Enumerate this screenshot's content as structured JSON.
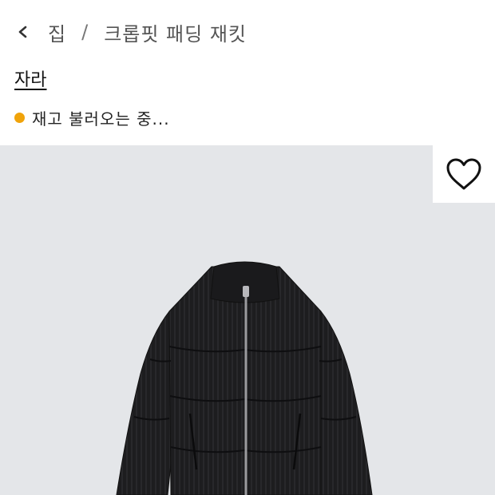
{
  "breadcrumb": {
    "home": "집",
    "separator": "/",
    "current": "크롭핏 패딩 재킷"
  },
  "brand": "자라",
  "stock": {
    "text": "재고 불러오는 중...",
    "dot_color": "#f0a30a"
  },
  "product": {
    "image_bg": "#e4e6e9",
    "favorite_icon": "heart-outline-icon",
    "back_icon": "chevron-left-icon"
  }
}
